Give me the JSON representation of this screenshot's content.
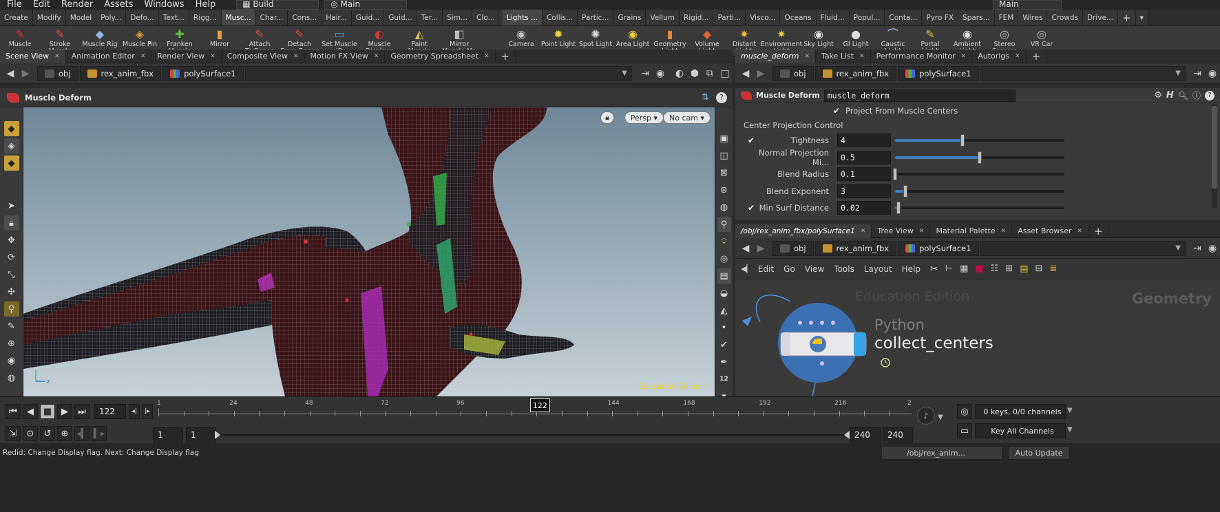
{
  "menubar": {
    "items": [
      "File",
      "Edit",
      "Render",
      "Assets",
      "Windows",
      "Help"
    ],
    "desktop": "Build",
    "context": "Main",
    "right_context": "Main"
  },
  "shelf": {
    "left_tabs": [
      "Create",
      "Modify",
      "Model",
      "Poly...",
      "Defo...",
      "Text...",
      "Rigg...",
      "Musc...",
      "Char...",
      "Cons...",
      "Hair...",
      "Guid...",
      "Guid...",
      "Ter...",
      "Sim...",
      "Clo..."
    ],
    "left_active": 7,
    "left_tools": [
      {
        "label": "Muscle",
        "icon": "muscle-icon"
      },
      {
        "label": "Stroke Muscle",
        "icon": "stroke-muscle-icon"
      },
      {
        "label": "Muscle Rig",
        "icon": "muscle-rig-icon"
      },
      {
        "label": "Muscle Pin",
        "icon": "muscle-pin-icon"
      },
      {
        "label": "Franken\nMuscle",
        "icon": "franken-muscle-icon"
      },
      {
        "label": "Mirror",
        "icon": "mirror-icon"
      },
      {
        "label": "Attach\nTo Bones",
        "icon": "attach-icon"
      },
      {
        "label": "Detach\nFrom Bones",
        "icon": "detach-icon"
      },
      {
        "label": "Set Muscle ID",
        "icon": "muscle-id-icon"
      },
      {
        "label": "Muscle\nDisplace",
        "icon": "muscle-displace-icon"
      },
      {
        "label": "Paint\nMuscle Mask",
        "icon": "paint-icon"
      },
      {
        "label": "Mirror\nMuscle Ma",
        "icon": "mirror-muscle-icon"
      }
    ],
    "right_tabs": [
      "Lights ...",
      "Collis...",
      "Partic...",
      "Grains",
      "Vellum",
      "Rigid...",
      "Parti...",
      "Visco...",
      "Oceans",
      "Fluid...",
      "Popul...",
      "Conta...",
      "Pyro FX",
      "Spars...",
      "FEM",
      "Wires",
      "Crowds",
      "Drive..."
    ],
    "right_active": 0,
    "right_tools": [
      {
        "label": "Camera",
        "icon": "camera-icon"
      },
      {
        "label": "Point Light",
        "icon": "point-light-icon"
      },
      {
        "label": "Spot Light",
        "icon": "spot-light-icon"
      },
      {
        "label": "Area Light",
        "icon": "area-light-icon"
      },
      {
        "label": "Geometry\nLight",
        "icon": "geometry-light-icon"
      },
      {
        "label": "Volume Light",
        "icon": "volume-light-icon"
      },
      {
        "label": "Distant Light",
        "icon": "distant-light-icon"
      },
      {
        "label": "Environment\nLight",
        "icon": "environment-light-icon"
      },
      {
        "label": "Sky Light",
        "icon": "sky-light-icon"
      },
      {
        "label": "GI Light",
        "icon": "gi-light-icon"
      },
      {
        "label": "Caustic Light",
        "icon": "caustic-light-icon"
      },
      {
        "label": "Portal Light",
        "icon": "portal-light-icon"
      },
      {
        "label": "Ambient Light",
        "icon": "ambient-light-icon"
      },
      {
        "label": "Stereo\nCamera",
        "icon": "stereo-camera-icon"
      },
      {
        "label": "VR Car",
        "icon": "vr-camera-icon"
      }
    ]
  },
  "left_pane": {
    "tabs": [
      "Scene View",
      "Animation Editor",
      "Render View",
      "Composite View",
      "Motion FX View",
      "Geometry Spreadsheet"
    ],
    "active_tab": 0,
    "path": [
      "obj",
      "rex_anim_fbx",
      "polySurface1"
    ],
    "node_title": "Muscle Deform",
    "persp": "Persp",
    "cam": "No cam",
    "watermark": "Education Edition"
  },
  "param_pane": {
    "tabs": [
      "muscle_deform",
      "Take List",
      "Performance Monitor",
      "Autorigs"
    ],
    "path": [
      "obj",
      "rex_anim_fbx",
      "polySurface1"
    ],
    "node_type": "Muscle Deform",
    "node_name": "muscle_deform",
    "toggle_label": "Project From Muscle Centers",
    "section": "Center Projection Control",
    "params": [
      {
        "label": "Tightness",
        "value": "4",
        "checked": true,
        "slider": 0.4
      },
      {
        "label": "Normal Projection Mi...",
        "value": "0.5",
        "checked": false,
        "slider": 0.5
      },
      {
        "label": "Blend Radius",
        "value": "0.1",
        "checked": false,
        "slider": 0.0
      },
      {
        "label": "Blend Exponent",
        "value": "3",
        "checked": false,
        "slider": 0.06
      },
      {
        "label": "Min Surf Distance",
        "value": "0.02",
        "checked": true,
        "slider": 0.02
      }
    ]
  },
  "net_pane": {
    "tabs": [
      "/obj/rex_anim_fbx/polySurface1",
      "Tree View",
      "Material Palette",
      "Asset Browser"
    ],
    "path": [
      "obj",
      "rex_anim_fbx",
      "polySurface1"
    ],
    "menu": [
      "Edit",
      "Go",
      "View",
      "Tools",
      "Layout",
      "Help"
    ],
    "watermark": "Education Edition",
    "context_label": "Geometry",
    "node_type": "Python",
    "node_name": "collect_centers"
  },
  "timeline": {
    "current_frame": "122",
    "ticks": [
      "1",
      "24",
      "48",
      "72",
      "96",
      "122",
      "144",
      "168",
      "192",
      "216",
      "2"
    ],
    "start": "1",
    "start2": "1",
    "end": "240",
    "end2": "240",
    "keys_label": "0 keys, 0/0 channels",
    "key_all": "Key All Channels"
  },
  "status": {
    "message": "Redid: Change Display flag. Next: Change Display flag",
    "path": "/obj/rex_anim...",
    "auto_update": "Auto Update"
  },
  "colors": {
    "accent": "#3f7fbf",
    "muscle": "#6b1f24",
    "python_node": "#3b73b8",
    "node_circle": "#9b6bd1"
  }
}
